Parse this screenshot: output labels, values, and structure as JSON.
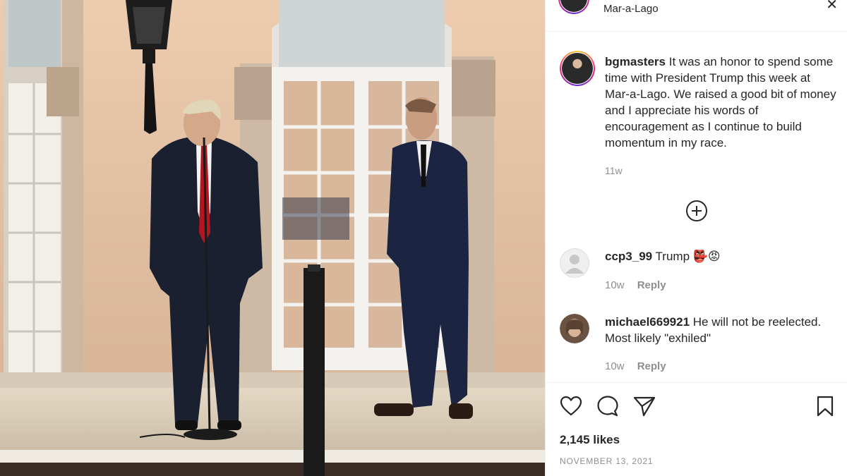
{
  "post": {
    "location": "Mar-a-Lago",
    "caption": {
      "username": "bgmasters",
      "text": "It was an honor to spend some time with President Trump this week at Mar-a-Lago. We raised a good bit of money and I appreciate his words of encouragement as I continue to build momentum in my race.",
      "time": "11w"
    },
    "load_more_label": "⊕",
    "comments": [
      {
        "username": "ccp3_99",
        "text": "Trump 👺😡",
        "time": "10w",
        "reply_label": "Reply"
      },
      {
        "username": "michael669921",
        "text": "He will not be reelected. Most likely \"exhiled\"",
        "time": "10w",
        "reply_label": "Reply"
      }
    ],
    "likes": "2,145 likes",
    "date": "NOVEMBER 13, 2021"
  },
  "icons": {
    "like": "heart-icon",
    "comment": "comment-icon",
    "share": "paper-plane-icon",
    "save": "bookmark-icon",
    "close": "close-icon",
    "add": "plus-circle-icon"
  },
  "colors": {
    "text": "#262626",
    "muted": "#8e8e8e",
    "border": "#efefef",
    "wall": "#e7c5a6"
  }
}
